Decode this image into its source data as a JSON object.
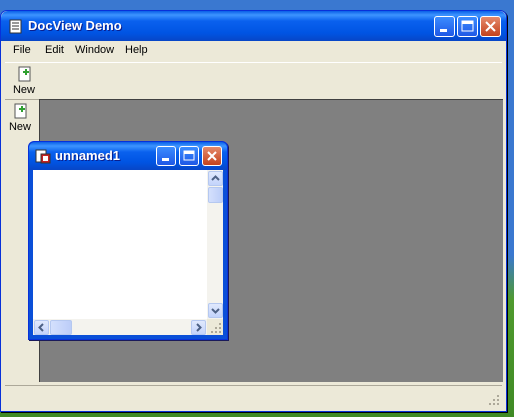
{
  "window": {
    "title": "DocView Demo"
  },
  "menu": {
    "items": [
      "File",
      "Edit",
      "Window",
      "Help"
    ]
  },
  "toolbar": {
    "new_label": "New"
  },
  "mdi_toolbar": {
    "new_label": "New"
  },
  "child": {
    "title": "unnamed1"
  },
  "colors": {
    "titlebar": "#0054e3",
    "mdi_background": "#808080",
    "window_face": "#ece9d8",
    "close": "#c4421c"
  },
  "icons": [
    "app-document-icon",
    "new-document-icon",
    "minimize-icon",
    "maximize-icon",
    "close-icon",
    "child-doc-icon",
    "scroll-up-icon",
    "scroll-down-icon",
    "scroll-left-icon",
    "scroll-right-icon",
    "resize-grip-icon"
  ]
}
